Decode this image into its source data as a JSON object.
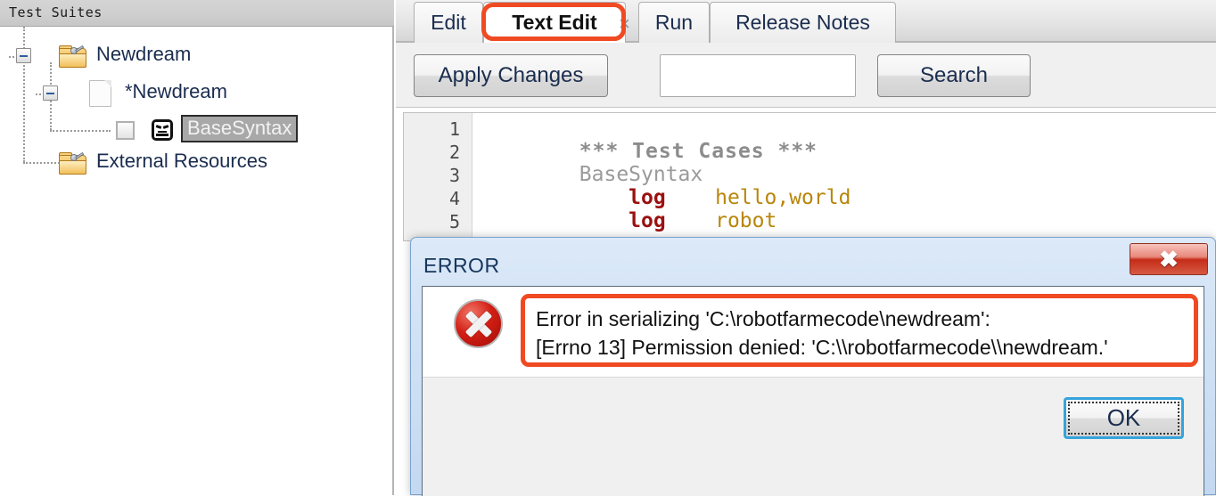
{
  "sidebar": {
    "header": "Test Suites",
    "tree": [
      {
        "label": "Newdream",
        "icon": "folder-key-icon",
        "expander": "minus",
        "depth": 0
      },
      {
        "label": "*Newdream",
        "icon": "document-icon",
        "expander": "minus",
        "depth": 1
      },
      {
        "label": "BaseSyntax",
        "icon": "robot-face-icon",
        "checkbox": "unchecked",
        "selected": true,
        "depth": 2
      },
      {
        "label": "External Resources",
        "icon": "folder-key-icon",
        "depth": 1
      }
    ]
  },
  "tabs": [
    {
      "label": "Edit",
      "active": false
    },
    {
      "label": "Text Edit",
      "active": true,
      "annotated": true
    },
    {
      "label": "Run",
      "active": false
    },
    {
      "label": "Release Notes",
      "active": false
    }
  ],
  "tab_close_glyph": "×",
  "toolbar": {
    "apply_changes_label": "Apply Changes",
    "search_label": "Search",
    "search_value": "",
    "search_placeholder": ""
  },
  "editor": {
    "line_numbers": [
      "1",
      "2",
      "3",
      "4",
      "5"
    ],
    "lines": [
      {
        "n": "1",
        "segments": [
          {
            "text": "*** Test Cases ***",
            "style": "c-head"
          }
        ]
      },
      {
        "n": "2",
        "segments": [
          {
            "text": "BaseSyntax",
            "style": "c-name"
          }
        ]
      },
      {
        "n": "3",
        "segments": [
          {
            "text": "    log",
            "style": "c-kw"
          },
          {
            "text": "    hello,world",
            "style": "c-arg"
          }
        ]
      },
      {
        "n": "4",
        "segments": [
          {
            "text": "    log",
            "style": "c-kw"
          },
          {
            "text": "    robot",
            "style": "c-arg"
          }
        ]
      },
      {
        "n": "5",
        "segments": []
      }
    ],
    "line1_text": "*** Test Cases ***",
    "line2_text": "BaseSyntax",
    "line3_kw": "    log",
    "line3_arg": "    hello,world",
    "line4_kw": "    log",
    "line4_arg": "    robot"
  },
  "dialog": {
    "title": "ERROR",
    "close_glyph": "✖",
    "icon": "error-circle-icon",
    "message_line1": "Error in serializing 'C:\\robotfarmecode\\newdream':",
    "message_line2": "[Errno 13] Permission denied: 'C:\\\\robotfarmecode\\\\newdream.'",
    "ok_label": "OK"
  },
  "annotations": {
    "color": "#f04a23",
    "targets": [
      "tab-text-edit",
      "dialog-message"
    ]
  },
  "colors": {
    "annotation": "#f04a23",
    "dialog_title_bar": "#cfe1f5",
    "selection": "#a8a8a8",
    "keyword": "#9b1111",
    "argument": "#b8860b",
    "comment": "#8c8c8c",
    "focus_border": "#35a3dd"
  }
}
